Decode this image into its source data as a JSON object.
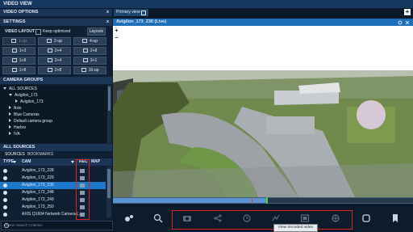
{
  "window": {
    "title": "VIDEO VIEW"
  },
  "video_options": {
    "title": "VIDEO OPTIONS",
    "collapse": "x"
  },
  "settings": {
    "title": "SETTINGS",
    "collapse": "x"
  },
  "layout": {
    "label": "VIDEO LAYOUT",
    "keep_optimized": "Keep optimized",
    "layouts_button": "Layouts",
    "buttons": [
      "1-up",
      "2-up",
      "4-up",
      "1+3",
      "2+4",
      "2+8",
      "1+8",
      "2+4",
      "3+1",
      "1+8",
      "2+8",
      "16-up"
    ]
  },
  "camera_groups": {
    "title": "CAMERA GROUPS",
    "items": [
      {
        "label": "ALL SOURCES",
        "indent": 0,
        "arrow": "down"
      },
      {
        "label": "Avigilon_173",
        "indent": 1,
        "arrow": "down"
      },
      {
        "label": "Avigilon_173",
        "indent": 2,
        "arrow": "none"
      },
      {
        "label": "Axis",
        "indent": 1,
        "arrow": "right"
      },
      {
        "label": "Blue Cameras",
        "indent": 1,
        "arrow": "right"
      },
      {
        "label": "Default camera group",
        "indent": 1,
        "arrow": "right"
      },
      {
        "label": "Harbor",
        "indent": 1,
        "arrow": "right"
      },
      {
        "label": "IVA",
        "indent": 1,
        "arrow": "right"
      }
    ]
  },
  "all_sources": {
    "title": "ALL SOURCES",
    "tabs": [
      "SOURCES",
      "BOOKMARKS"
    ],
    "columns": {
      "type": "TYPE",
      "cam": "CAM",
      "rec": "REC",
      "map": "MAP"
    },
    "rows": [
      {
        "name": "Avigilon_173_228",
        "selected": false
      },
      {
        "name": "Avigilon_173_229",
        "selected": false
      },
      {
        "name": "Avigilon_173_230",
        "selected": true
      },
      {
        "name": "Avigilon_173_248",
        "selected": false
      },
      {
        "name": "Avigilon_173_249",
        "selected": false
      },
      {
        "name": "Avigilon_173_250",
        "selected": false
      },
      {
        "name": "AXIS Q1604 Network Camera (...",
        "selected": false
      }
    ],
    "search_placeholder": "<Enter Search Criteria>"
  },
  "main": {
    "tab_label": "Primary view",
    "camera_title": "Avigilon_173_230 (Live)",
    "tooltip": "View recorded video",
    "toolbar_icons": [
      "ptz-icon",
      "zoom-icon",
      "snapshot-icon",
      "share-icon",
      "history-icon",
      "bookmark-icon",
      "video-record-icon",
      "ptz-preset-icon",
      "phone-icon",
      "flag-icon"
    ]
  },
  "colors": {
    "accent": "#1e6fb9",
    "selected": "#1d78c9",
    "highlight_box": "#e52020",
    "panel": "#0f2033"
  }
}
